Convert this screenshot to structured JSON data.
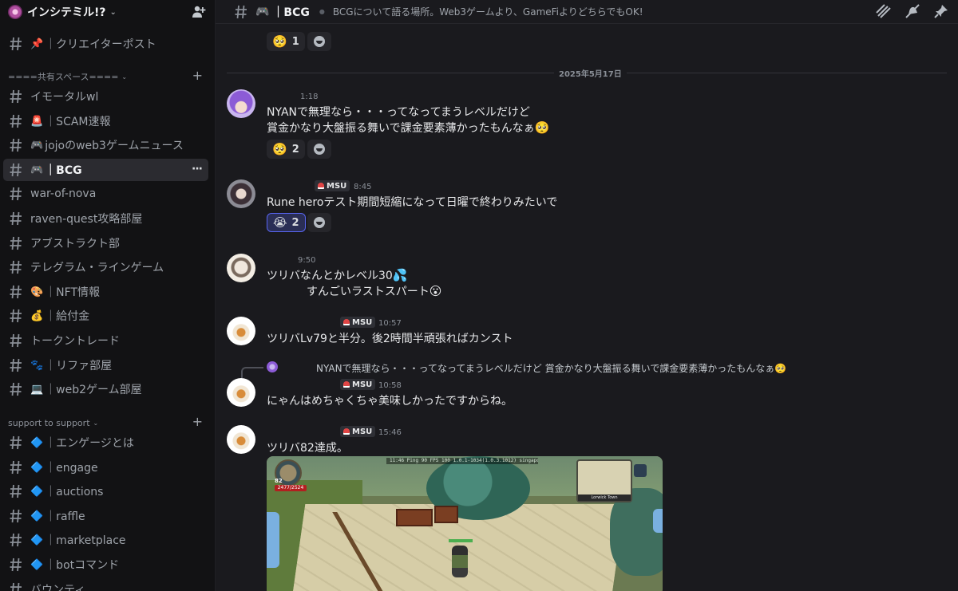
{
  "server": {
    "name": "インシテミル!?",
    "chevron": "chevron-down-icon"
  },
  "sidebar": {
    "channels_top": [
      {
        "emoji": "📌",
        "label": "｜クリエイターポスト"
      }
    ],
    "category1": {
      "label": "====共有スペース===="
    },
    "channels_shared": [
      {
        "emoji": "",
        "label": "イモータルwl"
      },
      {
        "emoji": "🚨",
        "label": "｜SCAM速報"
      },
      {
        "emoji": "🎮",
        "label": "jojoのweb3ゲームニュース"
      },
      {
        "emoji": "🎮",
        "label": "｜BCG",
        "active": true
      },
      {
        "emoji": "",
        "label": "war-of-nova"
      },
      {
        "emoji": "",
        "label": "raven-quest攻略部屋"
      },
      {
        "emoji": "",
        "label": "アブストラクト部"
      },
      {
        "emoji": "",
        "label": "テレグラム・ラインゲーム"
      },
      {
        "emoji": "🎨",
        "label": "｜NFT情報"
      },
      {
        "emoji": "💰",
        "label": "｜給付金"
      },
      {
        "emoji": "",
        "label": "トークントレード"
      },
      {
        "emoji": "🐾",
        "label": "｜リファ部屋"
      },
      {
        "emoji": "💻",
        "label": "｜web2ゲーム部屋"
      }
    ],
    "category2": {
      "label": "support to support"
    },
    "channels_support": [
      {
        "emoji": "🔷",
        "label": "｜エンゲージとは"
      },
      {
        "emoji": "🔷",
        "label": "｜engage"
      },
      {
        "emoji": "🔷",
        "label": "｜auctions"
      },
      {
        "emoji": "🔷",
        "label": "｜raffle"
      },
      {
        "emoji": "🔷",
        "label": "｜marketplace"
      },
      {
        "emoji": "🔷",
        "label": "｜botコマンド"
      },
      {
        "emoji": "",
        "label": "バウンティ"
      }
    ],
    "more_dots": "···"
  },
  "topbar": {
    "emoji": "🎮",
    "channel_name": "｜BCG",
    "topic": "BCGについて語る場所。Web3ゲームより、GameFiよりどちらでもOK!",
    "icons": [
      "threads-icon",
      "notification-muted-icon",
      "pin-icon"
    ]
  },
  "messages": {
    "top_reaction": {
      "emoji": "🥺",
      "count": "1"
    },
    "date_divider": "2025年5月17日",
    "m1": {
      "time": "1:18",
      "line1": "NYANで無理なら・・・ってなってまうレベルだけど",
      "line2": "賞金かなり大盤振る舞いで課金要素薄かったもんなぁ",
      "line2_emoji": "🥺",
      "reaction": {
        "emoji": "🥺",
        "count": "2"
      }
    },
    "m2": {
      "role": "MSU",
      "time": "8:45",
      "text": "Rune heroテスト期間短縮になって日曜で終わりみたいで",
      "reaction": {
        "emoji": "😭",
        "count": "2"
      }
    },
    "m3": {
      "time": "9:50",
      "line1": "ツリバなんとかレベル30",
      "line1_emoji": "💦",
      "line2": "すんごいラストスパート",
      "line2_emoji": "😮"
    },
    "m4": {
      "role": "MSU",
      "time": "10:57",
      "text": "ツリバLv79と半分。後2時間半頑張ればカンスト"
    },
    "m5": {
      "reply": "NYANで無理なら・・・ってなってまうレベルだけど 賞金かなり大盤振る舞いで課金要素薄かったもんなぁ",
      "reply_emoji": "🥺",
      "role": "MSU",
      "time": "10:58",
      "text": "にゃんはめちゃくちゃ美味しかったですからね。"
    },
    "m6": {
      "role": "MSU",
      "time": "15:46",
      "text": "ツリバ82達成。"
    }
  },
  "game": {
    "level": "82",
    "hp": "2477/2524",
    "hud": "11:46 Ping 90 FPS 100 1.0.1-1034(1.0.3.1012) singapore 10004",
    "minimap_label": "Lorwick Town"
  },
  "colors": {
    "background": "#1a1a1e",
    "sidebar": "#121214",
    "active_channel": "#2b2b30",
    "own_reaction_border": "#5865f2",
    "role_icon": "#e04545"
  }
}
